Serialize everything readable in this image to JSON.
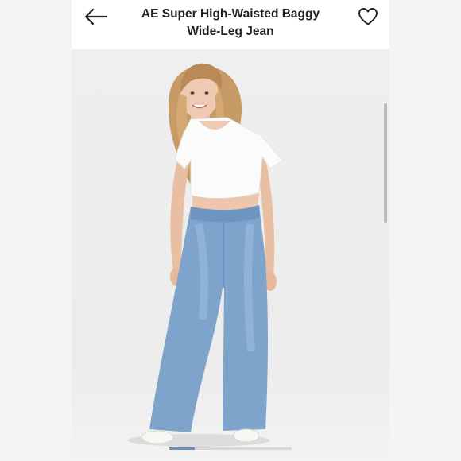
{
  "header": {
    "title_line1": "AE Super High-Waisted Baggy",
    "title_line2": "Wide-Leg Jean",
    "back_icon": "arrow-left-icon",
    "favorite_icon": "heart-outline-icon"
  },
  "gallery": {
    "image_subject": "model-wearing-wide-leg-jeans",
    "current_image_index": 1,
    "active_indicator_color": "#6d8fb5"
  },
  "colors": {
    "denim": "#7ea4cc",
    "background": "#ededed"
  }
}
